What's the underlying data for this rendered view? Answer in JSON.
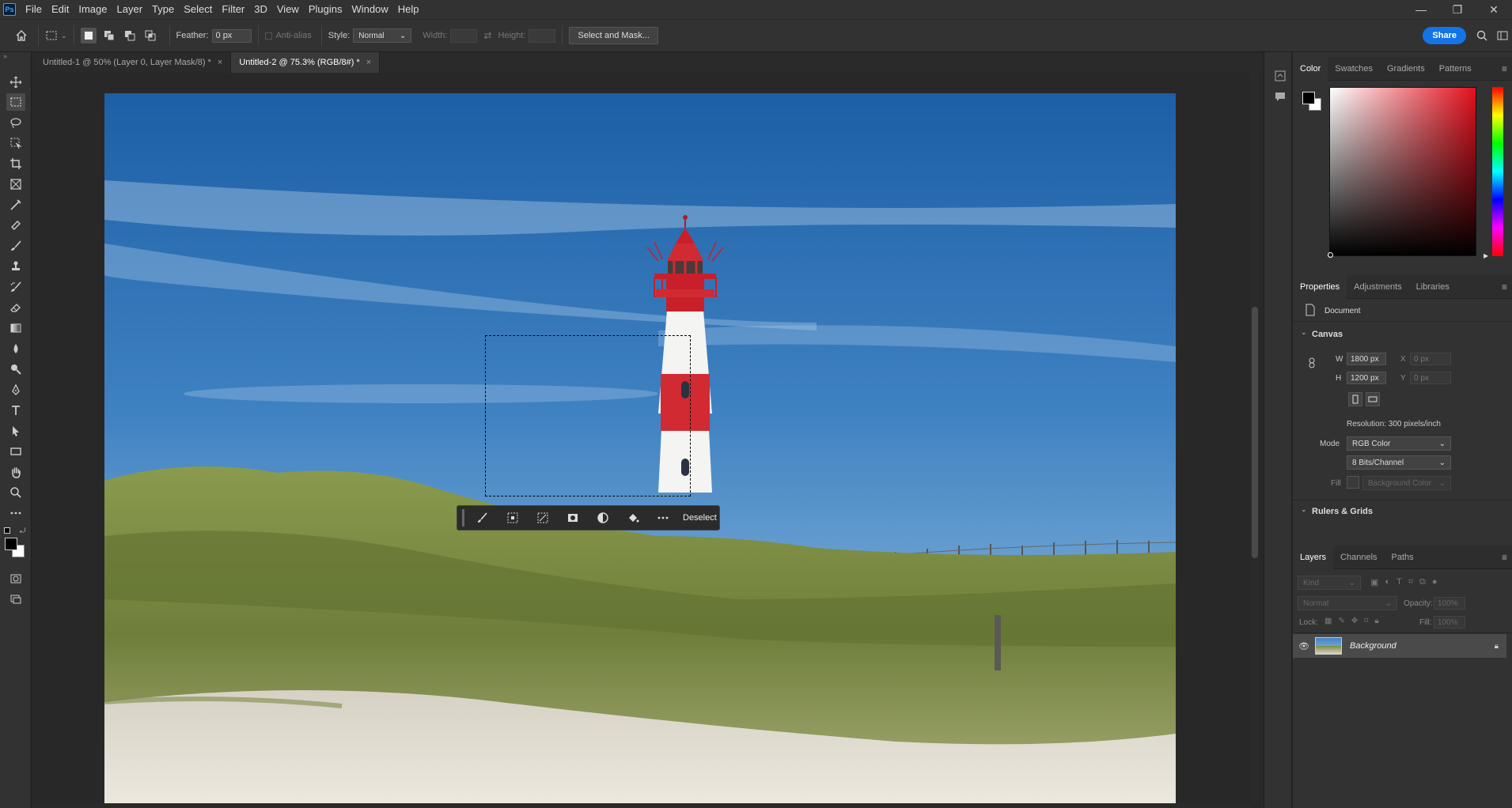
{
  "app": {
    "logo_text": "Ps"
  },
  "menu": [
    "File",
    "Edit",
    "Image",
    "Layer",
    "Type",
    "Select",
    "Filter",
    "3D",
    "View",
    "Plugins",
    "Window",
    "Help"
  ],
  "window_controls": {
    "minimize": "—",
    "restore": "❐",
    "close": "✕"
  },
  "options": {
    "feather_label": "Feather:",
    "feather_value": "0 px",
    "antialias_label": "Anti-alias",
    "style_label": "Style:",
    "style_value": "Normal",
    "width_label": "Width:",
    "height_label": "Height:",
    "select_mask_label": "Select and Mask...",
    "share_label": "Share"
  },
  "tabs": [
    {
      "label": "Untitled-1 @ 50% (Layer 0, Layer Mask/8) *",
      "close": "×"
    },
    {
      "label": "Untitled-2 @ 75.3% (RGB/8#) *",
      "close": "×"
    }
  ],
  "context_bar": {
    "deselect_label": "Deselect"
  },
  "color_panel": {
    "tabs": [
      "Color",
      "Swatches",
      "Gradients",
      "Patterns"
    ]
  },
  "properties_panel": {
    "tabs": [
      "Properties",
      "Adjustments",
      "Libraries"
    ],
    "doc_label": "Document",
    "canvas_header": "Canvas",
    "w_label": "W",
    "w_value": "1800 px",
    "h_label": "H",
    "h_value": "1200 px",
    "x_label": "X",
    "x_placeholder": "0 px",
    "y_label": "Y",
    "y_placeholder": "0 px",
    "resolution": "Resolution: 300 pixels/inch",
    "mode_label": "Mode",
    "mode_value": "RGB Color",
    "bits_value": "8 Bits/Channel",
    "fill_label": "Fill",
    "fill_value": "Background Color",
    "rulers_header": "Rulers & Grids"
  },
  "layers_panel": {
    "tabs": [
      "Layers",
      "Channels",
      "Paths"
    ],
    "kind_placeholder": "Kind",
    "blend_mode": "Normal",
    "opacity_label": "Opacity:",
    "opacity_value": "100%",
    "lock_label": "Lock:",
    "fill_label": "Fill:",
    "fill_value": "100%",
    "layers": [
      {
        "name": "Background",
        "locked": true,
        "visible": true
      }
    ]
  },
  "colors": {
    "accent": "#1473e6",
    "foreground": "#000000",
    "background": "#ffffff"
  }
}
